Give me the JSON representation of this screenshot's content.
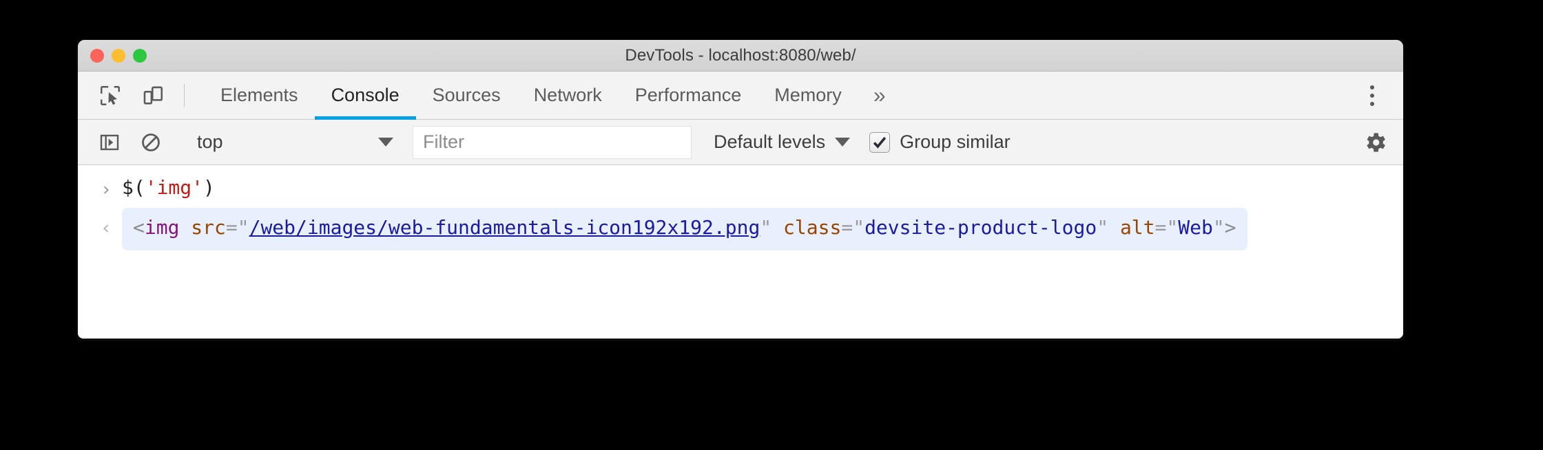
{
  "window": {
    "title": "DevTools - localhost:8080/web/",
    "traffic_lights": [
      {
        "name": "close",
        "color": "#fa6459"
      },
      {
        "name": "minimize",
        "color": "#ffbe2d"
      },
      {
        "name": "zoom",
        "color": "#2bc840"
      }
    ]
  },
  "tabbar": {
    "inspect_icon": "inspect-element-icon",
    "device_icon": "device-toolbar-icon",
    "tabs": [
      {
        "label": "Elements",
        "active": false
      },
      {
        "label": "Console",
        "active": true
      },
      {
        "label": "Sources",
        "active": false
      },
      {
        "label": "Network",
        "active": false
      },
      {
        "label": "Performance",
        "active": false
      },
      {
        "label": "Memory",
        "active": false
      }
    ],
    "more_tabs": "»",
    "menu_icon": "more-options-icon",
    "active_underline_color": "#03a0e6"
  },
  "console_toolbar": {
    "sidebar_icon": "console-sidebar-icon",
    "clear_icon": "clear-console-icon",
    "context": {
      "value": "top",
      "caret": "chevron-down-icon"
    },
    "filter": {
      "value": "",
      "placeholder": "Filter"
    },
    "levels": {
      "label": "Default levels",
      "caret": "chevron-down-icon"
    },
    "group_similar": {
      "label": "Group similar",
      "checked": true
    },
    "settings_icon": "settings-gear-icon"
  },
  "console": {
    "input": {
      "prompt": "›",
      "plain_1": "$(",
      "quote_open": "'",
      "string": "img",
      "quote_close": "'",
      "plain_2": ")"
    },
    "result": {
      "arrow": "‹",
      "open_bracket": "<",
      "tag": "img",
      "space_1": " ",
      "attr_src": "src",
      "eq_1": "=",
      "quote_1": "\"",
      "src_value": "/web/images/web-fundamentals-icon192x192.png",
      "quote_2": "\"",
      "space_2": " ",
      "attr_class": "class",
      "eq_2": "=",
      "quote_3": "\"",
      "class_value": "devsite-product-logo",
      "quote_4": "\"",
      "space_3": " ",
      "attr_alt": "alt",
      "eq_3": "=",
      "quote_5": "\"",
      "alt_value": "Web",
      "quote_6": "\"",
      "close_bracket": ">"
    }
  }
}
